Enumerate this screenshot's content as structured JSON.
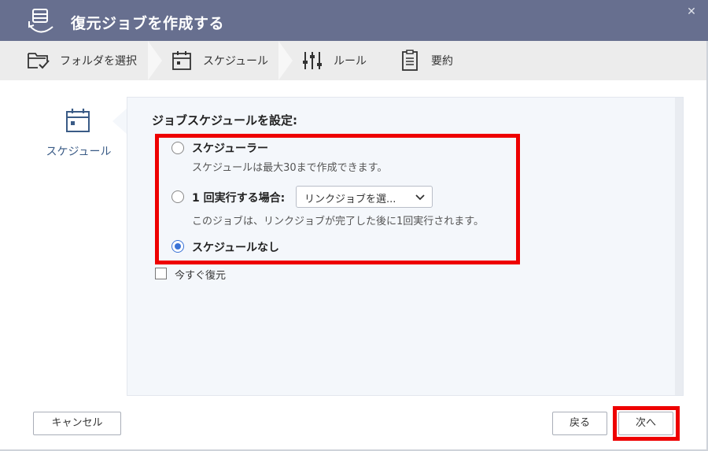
{
  "window": {
    "title": "復元ジョブを作成する",
    "close_symbol": "✕"
  },
  "steps": [
    {
      "label": "フォルダを選択",
      "icon": "folder-check-icon"
    },
    {
      "label": "スケジュール",
      "icon": "calendar-icon",
      "active": true
    },
    {
      "label": "ルール",
      "icon": "sliders-icon"
    },
    {
      "label": "要約",
      "icon": "clipboard-list-icon"
    }
  ],
  "leftnav": {
    "label": "スケジュール",
    "icon": "calendar-icon"
  },
  "schedule": {
    "title": "ジョブスケジュールを設定:",
    "options": [
      {
        "label": "スケジューラー",
        "description": "スケジュールは最大30まで作成できます。",
        "selected": false
      },
      {
        "label": "1 回実行する場合:",
        "description": "このジョブは、リンクジョブが完了した後に1回実行されます。",
        "selected": false
      },
      {
        "label": "スケジュールなし",
        "selected": true
      }
    ],
    "link_job_select": {
      "value": "リンクジョブを選..."
    },
    "restore_now": {
      "label": "今すぐ復元",
      "checked": false
    }
  },
  "footer": {
    "cancel_label": "キャンセル",
    "back_label": "戻る",
    "next_label": "次へ"
  },
  "colors": {
    "titlebar": "#676f8f",
    "accent": "#3a73d6",
    "highlight": "#ee0000",
    "nav_text": "#3a5b86"
  }
}
